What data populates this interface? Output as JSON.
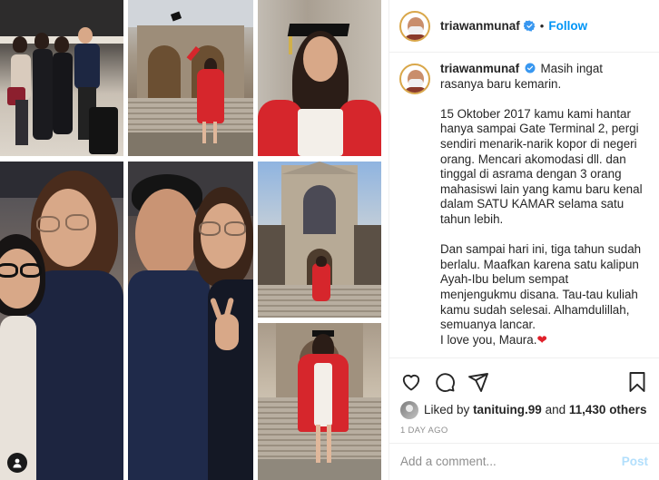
{
  "header": {
    "username": "triawanmunaf",
    "separator": "•",
    "follow_label": "Follow"
  },
  "caption": {
    "username": "triawanmunaf",
    "paragraphs": [
      "Masih ingat rasanya baru kemarin.",
      "15 Oktober 2017 kamu kami hantar hanya sampai Gate Terminal 2, pergi sendiri menarik-narik kopor di negeri orang. Mencari akomodasi dll. dan tinggal di asrama dengan 3 orang mahasiswi lain yang kamu baru kenal dalam SATU KAMAR selama satu tahun lebih.",
      "Dan sampai hari ini, tiga tahun sudah berlalu. Maafkan karena satu kalipun Ayah-Ibu belum sempat menjengukmu disana. Tau-tau kuliah kamu sudah selesai. Alhamdulillah, semuanya lancar."
    ],
    "closing": "I love you, Maura.",
    "heart": "❤"
  },
  "likes": {
    "prefix": "Liked by",
    "liker": "tanituing.99",
    "joiner": "and",
    "others": "11,430 others"
  },
  "timestamp": "1 DAY AGO",
  "comment": {
    "placeholder": "Add a comment...",
    "post_label": "Post"
  },
  "icons": {
    "like": "heart-outline-icon",
    "comment": "comment-bubble-icon",
    "share": "paper-plane-icon",
    "save": "bookmark-icon",
    "verified": "verified-badge-icon",
    "photo_tag": "user-tag-icon"
  },
  "colors": {
    "accent": "#0095f6",
    "verified": "#3897f0",
    "post_disabled": "#b2dffc",
    "heart": "#e0202a"
  }
}
